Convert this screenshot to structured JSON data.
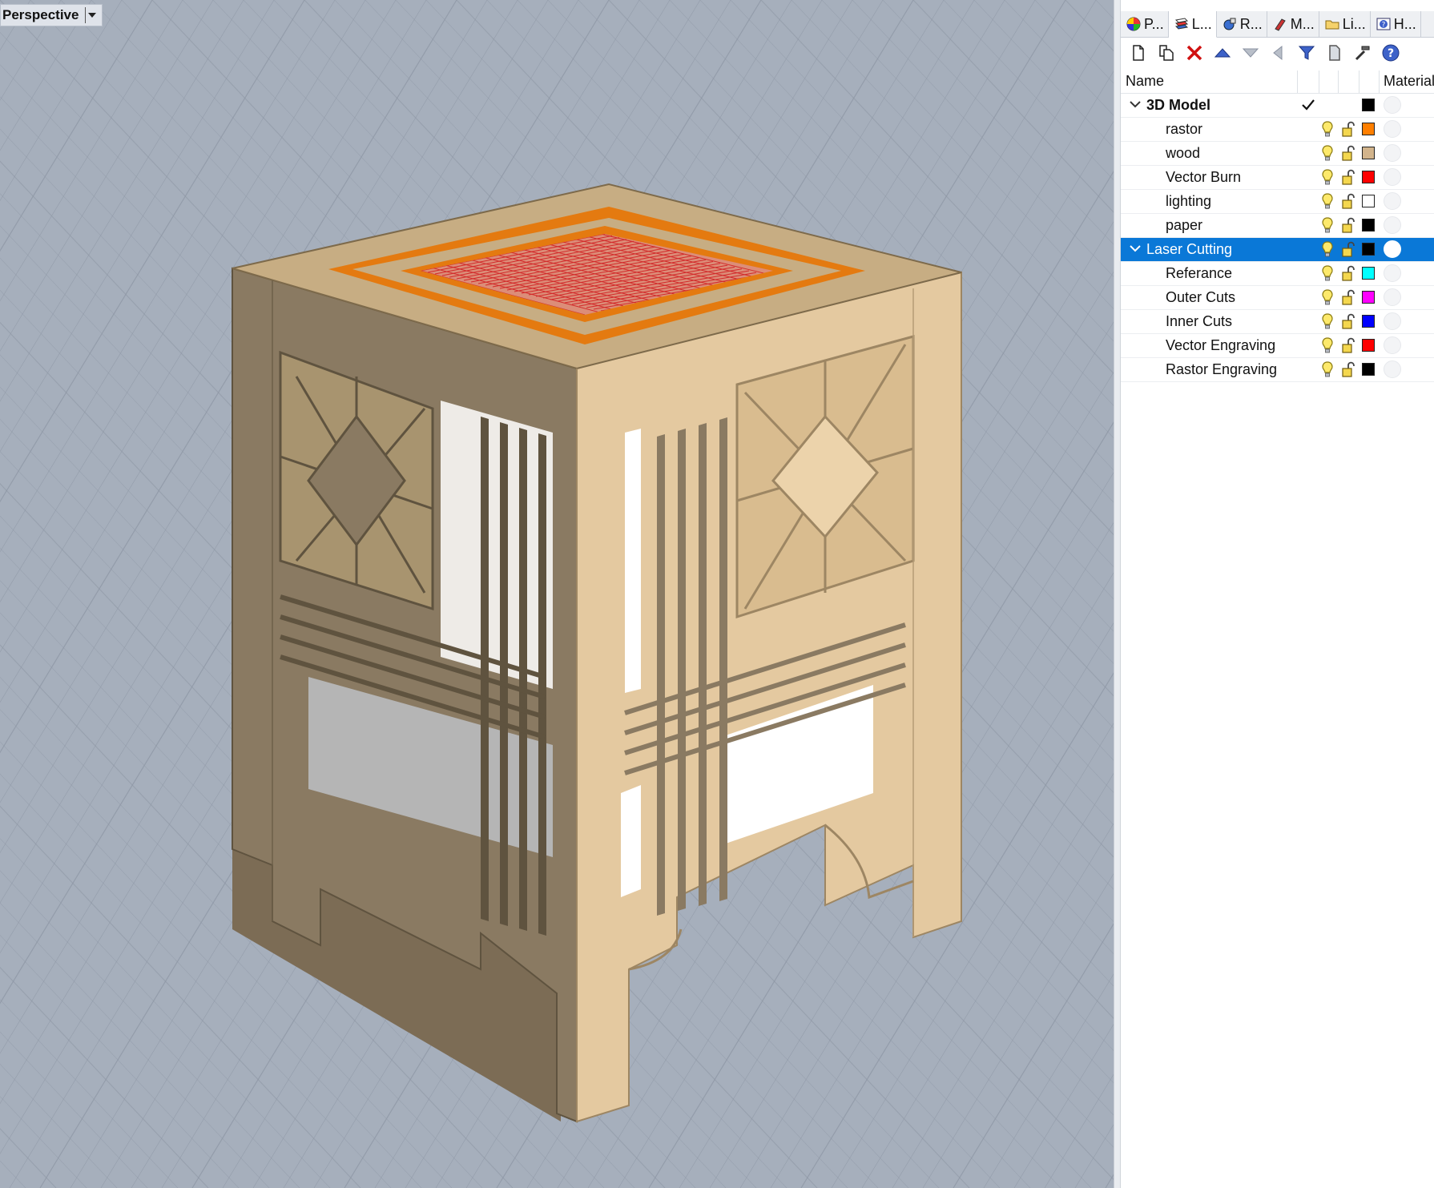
{
  "viewport": {
    "label": "Perspective",
    "background_color": "#a6afbc",
    "grid_color": "#8f98a6",
    "model_color": "#e4c9a0",
    "model_shadow_color": "#8a7a62",
    "top_highlight_color": "#e47a10",
    "top_cross_color": "#d22a2a"
  },
  "panel": {
    "tabs": [
      {
        "icon": "properties-icon",
        "label": "P..."
      },
      {
        "icon": "layers-icon",
        "label": "L..."
      },
      {
        "icon": "render-icon",
        "label": "R..."
      },
      {
        "icon": "materials-icon",
        "label": "M..."
      },
      {
        "icon": "libraries-icon",
        "label": "Li..."
      },
      {
        "icon": "help-icon",
        "label": "H..."
      }
    ],
    "toolbar": [
      {
        "name": "new-layer-button",
        "icon": "new-document-icon"
      },
      {
        "name": "new-sublayer-button",
        "icon": "copy-document-icon"
      },
      {
        "name": "delete-layer-button",
        "icon": "delete-x-icon"
      },
      {
        "name": "move-layer-up-button",
        "icon": "arrow-up-icon"
      },
      {
        "name": "move-layer-down-button",
        "icon": "arrow-down-icon"
      },
      {
        "name": "move-layer-out-button",
        "icon": "arrow-left-icon"
      },
      {
        "name": "filter-button",
        "icon": "filter-icon"
      },
      {
        "name": "layer-states-button",
        "icon": "page-icon"
      },
      {
        "name": "tools-button",
        "icon": "hammer-icon"
      },
      {
        "name": "help-button",
        "icon": "help-icon"
      }
    ],
    "columns": {
      "name": "Name",
      "material": "Material"
    },
    "layers": [
      {
        "name": "3D Model",
        "level": 0,
        "expanded": true,
        "current": true,
        "color": "#000000",
        "selected": false,
        "bold": true
      },
      {
        "name": "rastor",
        "level": 1,
        "color": "#ff7f00"
      },
      {
        "name": "wood",
        "level": 1,
        "color": "#d2b48c"
      },
      {
        "name": "Vector Burn",
        "level": 1,
        "color": "#ff0000"
      },
      {
        "name": "lighting",
        "level": 1,
        "color": "#ffffff"
      },
      {
        "name": "paper",
        "level": 1,
        "color": "#000000"
      },
      {
        "name": "Laser Cutting",
        "level": 0,
        "expanded": true,
        "current": false,
        "color": "#000000",
        "selected": true
      },
      {
        "name": "Referance",
        "level": 1,
        "color": "#00ffff"
      },
      {
        "name": "Outer Cuts",
        "level": 1,
        "color": "#ff00ff"
      },
      {
        "name": "Inner Cuts",
        "level": 1,
        "color": "#0000ff"
      },
      {
        "name": "Vector Engraving",
        "level": 1,
        "color": "#ff0000"
      },
      {
        "name": "Rastor Engraving",
        "level": 1,
        "color": "#000000"
      }
    ]
  }
}
